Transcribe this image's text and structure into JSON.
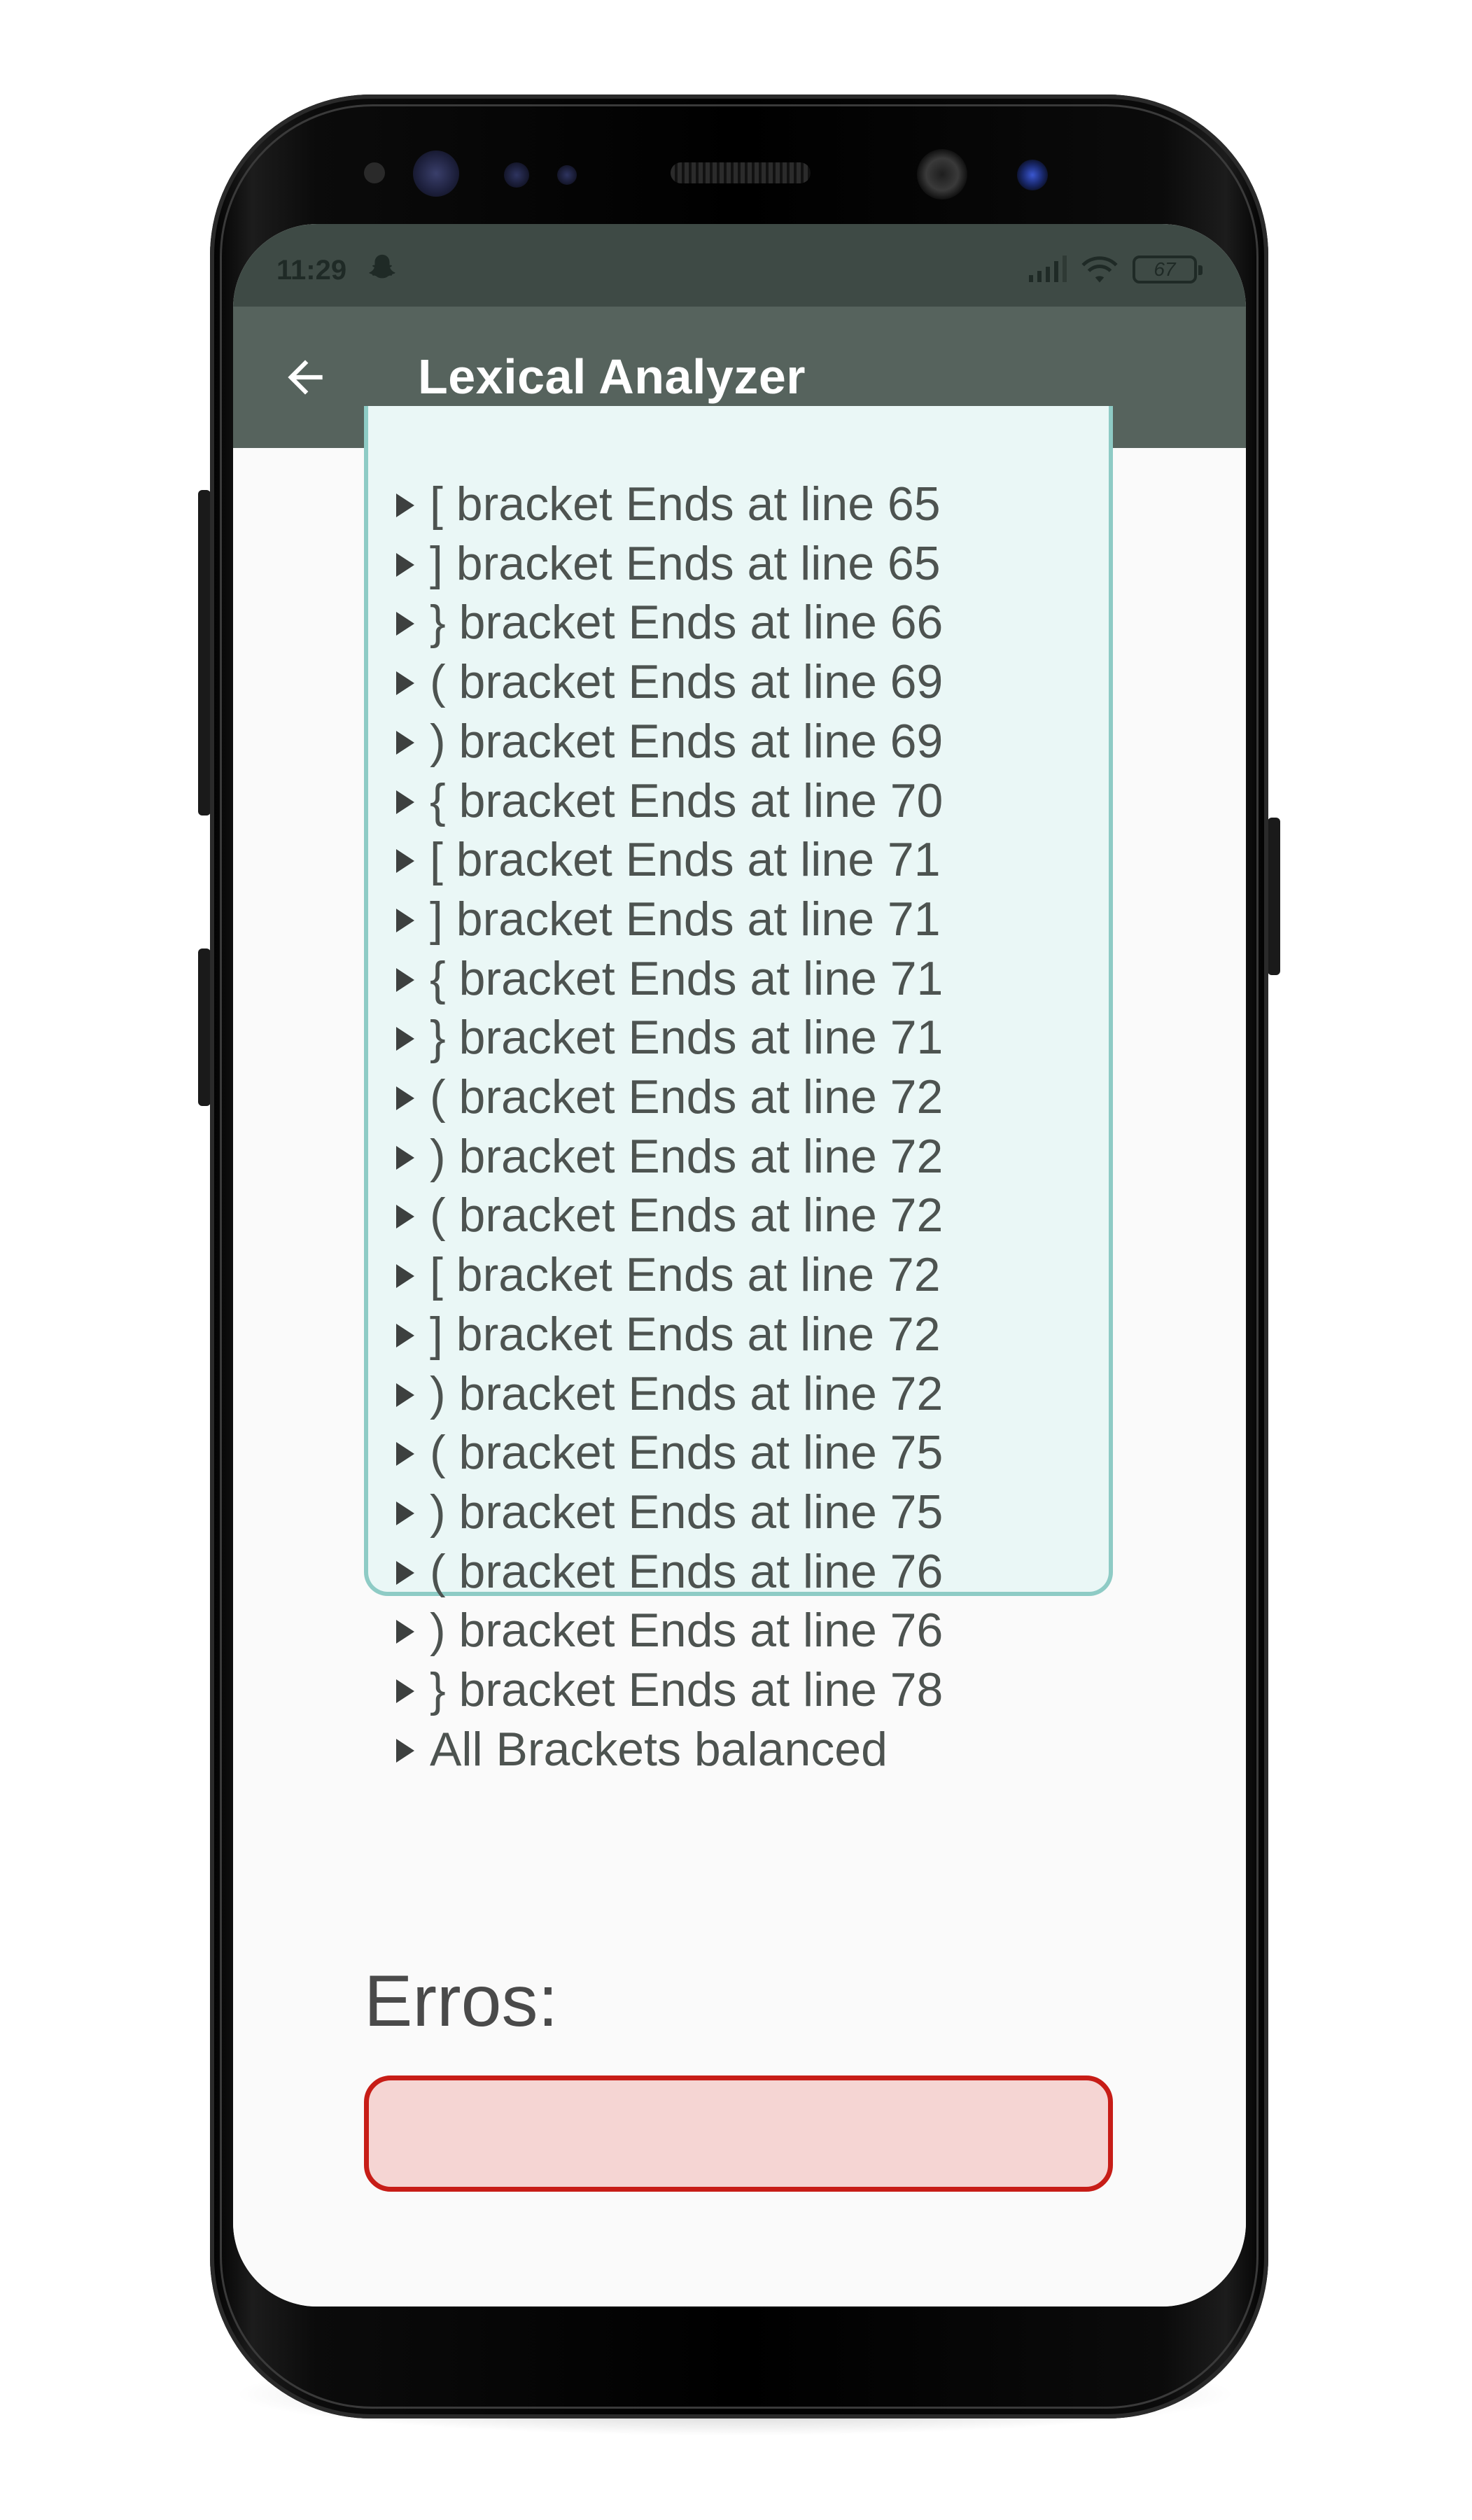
{
  "status": {
    "time": "11:29",
    "battery": "67"
  },
  "appbar": {
    "title": "Lexical Analyzer"
  },
  "results": {
    "lines": [
      "[ bracket Ends at line 65",
      "] bracket Ends at line 65",
      "} bracket Ends at line 66",
      "( bracket Ends at line 69",
      ") bracket Ends at line 69",
      "{ bracket Ends at line 70",
      "[ bracket Ends at line 71",
      "] bracket Ends at line 71",
      "{ bracket Ends at line 71",
      "} bracket Ends at line 71",
      "( bracket Ends at line 72",
      ") bracket Ends at line 72",
      "( bracket Ends at line 72",
      "[ bracket Ends at line 72",
      "] bracket Ends at line 72",
      ") bracket Ends at line 72",
      "( bracket Ends at line 75",
      ") bracket Ends at line 75",
      "( bracket Ends at line 76",
      ") bracket Ends at line 76",
      "} bracket Ends at line 78",
      "All Brackets balanced"
    ]
  },
  "errors": {
    "label": "Erros:",
    "value": ""
  },
  "colors": {
    "statusbar": "#3e4a45",
    "appbar": "#56635d",
    "result_bg": "#eaf7f6",
    "result_border": "#8ecbc5",
    "error_bg": "#f5d5d3",
    "error_border": "#c71d17"
  },
  "icons": {
    "back": "arrow-left-icon",
    "notification": "snapchat-ghost-icon",
    "signal": "signal-bars-icon",
    "wifi": "wifi-icon",
    "battery": "battery-icon"
  }
}
